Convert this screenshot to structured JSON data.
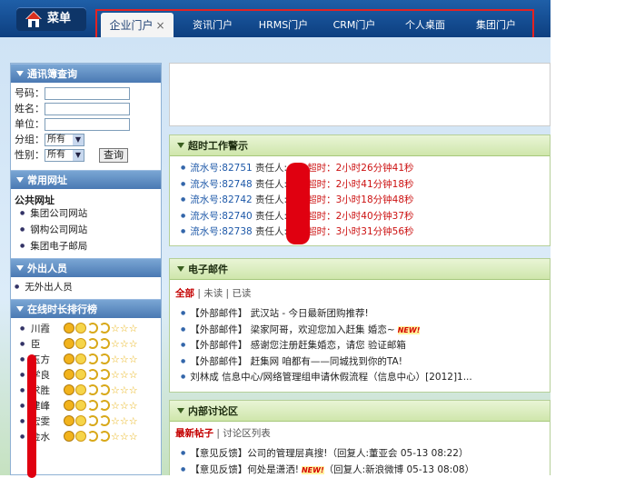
{
  "header": {
    "menu_label": "菜单",
    "tabs": [
      {
        "label": "企业门户",
        "close": "×"
      },
      {
        "label": "资讯门户"
      },
      {
        "label": "HRMS门户"
      },
      {
        "label": "CRM门户"
      },
      {
        "label": "个人桌面"
      },
      {
        "label": "集团门户"
      }
    ]
  },
  "sidebar": {
    "directory": {
      "title": "通讯簿查询",
      "fields": [
        "号码：",
        "姓名：",
        "单位："
      ],
      "group_label": "分组：",
      "group_value": "所有",
      "gender_label": "性别：",
      "gender_value": "所有",
      "search_button": "查询"
    },
    "links": {
      "title": "常用网址",
      "subtitle": "公共网址",
      "items": [
        "集团公司网站",
        "钢构公司网站",
        "集团电子邮局"
      ]
    },
    "outside": {
      "title": "外出人员",
      "items": [
        "无外出人员"
      ]
    },
    "ranking": {
      "title": "在线时长排行榜",
      "names": [
        "川霞",
        "臣",
        "玉方",
        "学良",
        "求胜",
        "建峰",
        "宏雯",
        "金水"
      ]
    }
  },
  "alerts": {
    "title": "超时工作警示",
    "rows": [
      {
        "no": "流水号:82751",
        "resp": "责任人:",
        "time": "超时：2小时26分钟41秒"
      },
      {
        "no": "流水号:82748",
        "resp": "责任人:",
        "time": "超时：2小时41分钟18秒"
      },
      {
        "no": "流水号:82742",
        "resp": "责任人:",
        "time": "超时：3小时18分钟48秒"
      },
      {
        "no": "流水号:82740",
        "resp": "责任人:",
        "time": "超时：2小时40分钟37秒"
      },
      {
        "no": "流水号:82738",
        "resp": "责任人:",
        "time": "超时：3小时31分钟56秒"
      }
    ]
  },
  "email": {
    "title": "电子邮件",
    "filters": [
      "全部",
      "未读",
      "已读"
    ],
    "rows": [
      {
        "text": "【外部邮件】 武汉站 - 今日最新团购推荐!",
        "new": ""
      },
      {
        "text": "【外部邮件】 梁家阿哥，欢迎您加入赶集 婚恋~",
        "new": "NEW!"
      },
      {
        "text": "【外部邮件】 感谢您注册赶集婚恋，请您 验证邮箱",
        "new": ""
      },
      {
        "text": "【外部邮件】 赶集网 咱都有——同城找到你的TA!",
        "new": ""
      },
      {
        "text": "刘林成 信息中心/网络管理组申请休假流程（信息中心）[2012]1...",
        "new": ""
      }
    ]
  },
  "discussion": {
    "title": "内部讨论区",
    "filters": [
      "最新帖子",
      "讨论区列表"
    ],
    "rows": [
      {
        "text": "【意见反馈】公司的管理层真搜!（回复人:董亚会 05-13 08:22）",
        "new": ""
      },
      {
        "text": "【意见反馈】何处是潇洒!",
        "new": "NEW!",
        "extra": "（回复人:新浪微博 05-13 08:08）"
      }
    ]
  },
  "colors": {
    "accent_red": "#e32222",
    "header_blue": "#0d3f80",
    "section_green": "#cfe6ab"
  }
}
